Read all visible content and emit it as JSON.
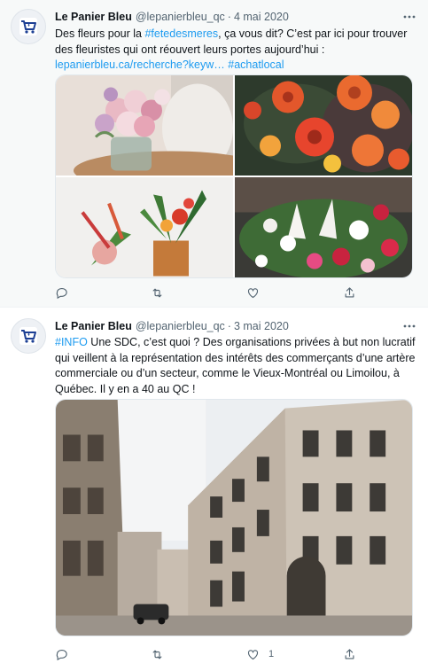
{
  "tweets": [
    {
      "name": "Le Panier Bleu",
      "handle": "@lepanierbleu_qc",
      "separator": "·",
      "date": "4 mai 2020",
      "text_part1": "Des fleurs pour la ",
      "hashtag1": "#fetedesmeres",
      "text_part2": ", ça vous dit? C’est par ici pour trouver des fleuristes qui ont réouvert leurs portes aujourd’hui  : ",
      "url": "lepanierbleu.ca/recherche?keyw…",
      "text_part3": " ",
      "hashtag2": "#achatlocal",
      "reply_count": "",
      "retweet_count": "",
      "like_count": ""
    },
    {
      "name": "Le Panier Bleu",
      "handle": "@lepanierbleu_qc",
      "separator": "·",
      "date": "3 mai 2020",
      "hashtag1": "#INFO",
      "text_part1": " Une SDC, c’est quoi ? Des organisations privées à but non lucratif qui veillent à la représentation des intérêts des commerçants d’une artère commerciale ou d’un secteur, comme le Vieux-Montréal ou Limoilou, à Québec. Il y en a 40 au QC !",
      "reply_count": "",
      "retweet_count": "",
      "like_count": "1"
    }
  ],
  "icons": {
    "avatar": "cart-icon",
    "more": "more-dots-icon",
    "reply": "reply-icon",
    "retweet": "retweet-icon",
    "like": "heart-icon",
    "share": "share-icon"
  },
  "colors": {
    "link": "#1d9bf0",
    "brand_blue": "#1c3f94",
    "muted": "#536471",
    "highlight_bg": "#f7f9f9"
  }
}
